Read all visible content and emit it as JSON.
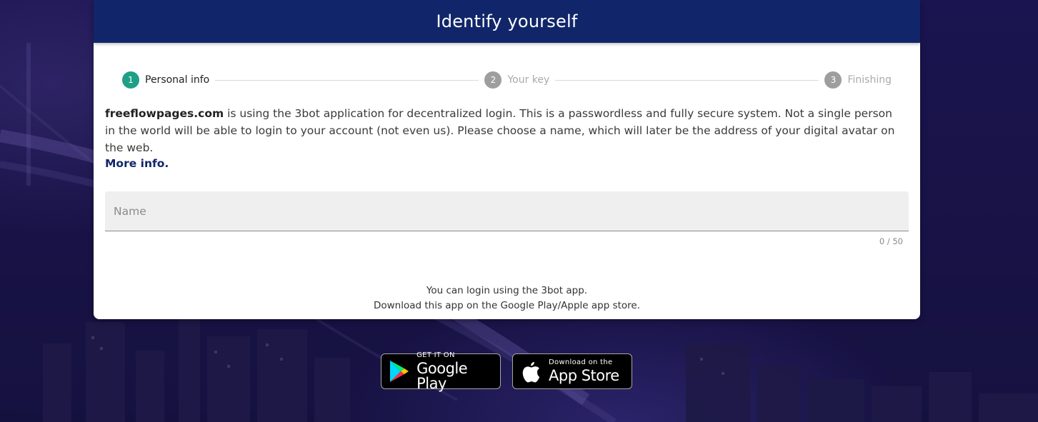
{
  "header": {
    "title": "Identify yourself"
  },
  "stepper": {
    "steps": [
      {
        "number": "1",
        "label": "Personal info",
        "state": "active"
      },
      {
        "number": "2",
        "label": "Your key",
        "state": "inactive"
      },
      {
        "number": "3",
        "label": "Finishing",
        "state": "inactive"
      }
    ]
  },
  "description": {
    "site": "freeflowpages.com",
    "text": " is using the 3bot application for decentralized login. This is a passwordless and fully secure system. Not a single person in the world will be able to login to your account (not even us). Please choose a name, which will later be the address of your digital avatar on the web."
  },
  "more_info": {
    "label": "More info."
  },
  "name_field": {
    "placeholder": "Name",
    "value": "",
    "counter": "0 / 50"
  },
  "login_note": {
    "line1": "You can login using the 3bot app.",
    "line2": "Download this app on the Google Play/Apple app store."
  },
  "store_badges": {
    "google": {
      "small": "GET IT ON",
      "big": "Google Play"
    },
    "apple": {
      "small": "Download on the",
      "big": "App Store"
    }
  },
  "colors": {
    "header_bg": "#11266a",
    "step_active": "#1f9f86",
    "step_inactive": "#9e9e9e",
    "link": "#11266a"
  }
}
